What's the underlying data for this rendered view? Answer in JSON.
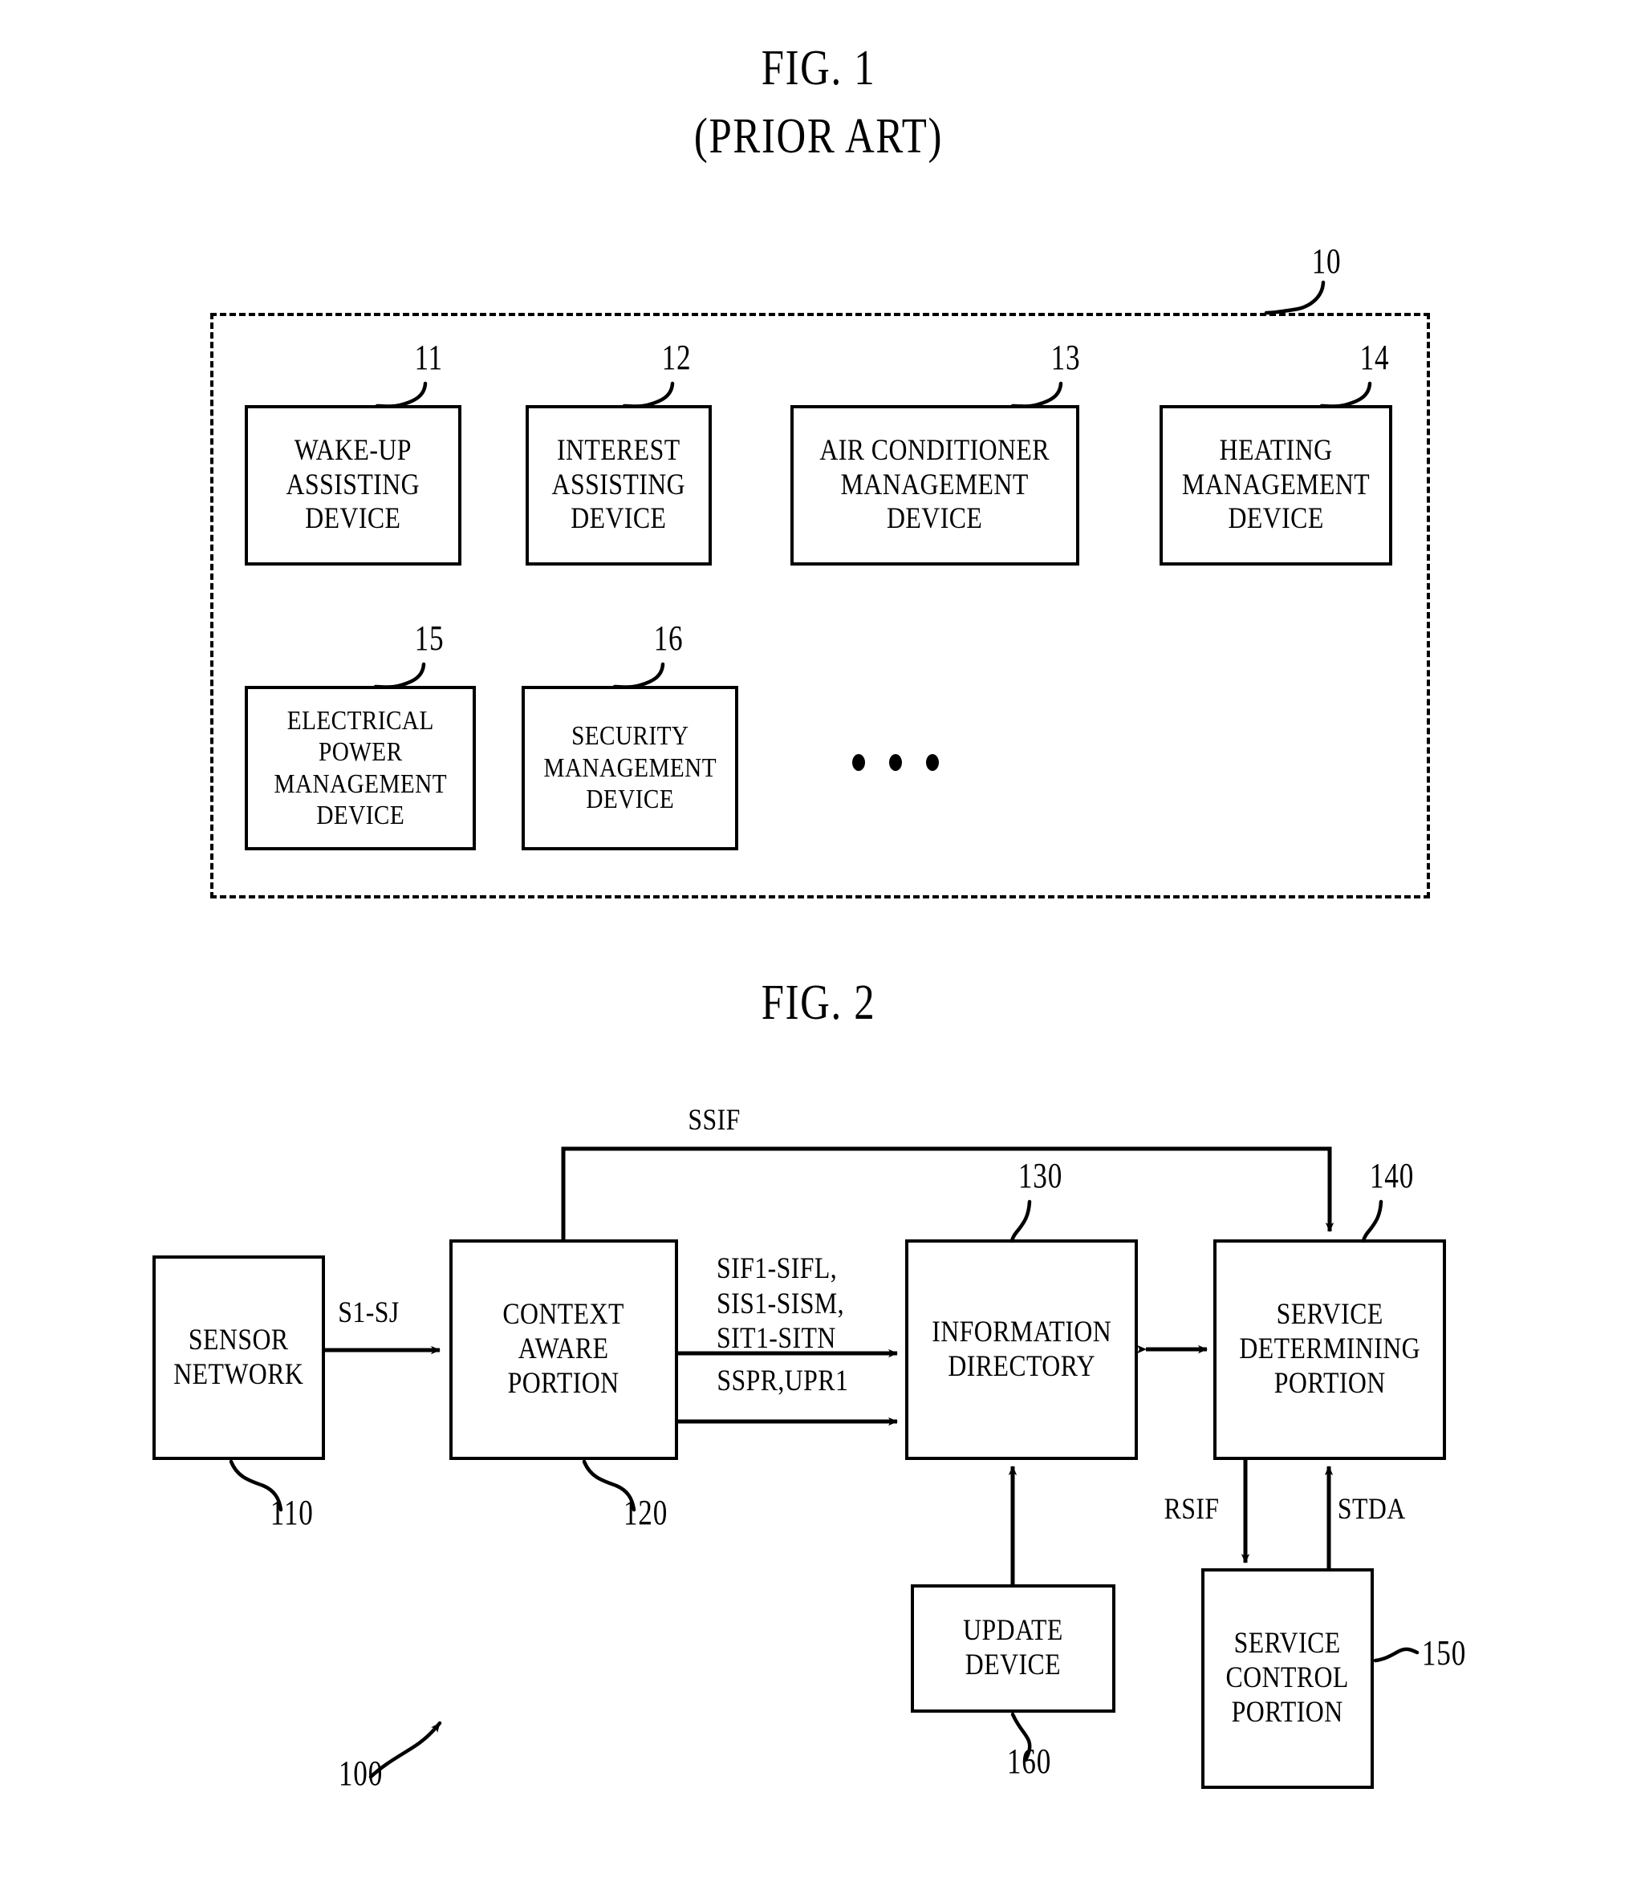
{
  "figures": [
    {
      "id": "fig1",
      "title_line1": "FIG. 1",
      "title_line2": "(PRIOR ART)",
      "container_ref": "10",
      "boxes": [
        {
          "ref": "11",
          "label": "WAKE-UP\nASSISTING\nDEVICE"
        },
        {
          "ref": "12",
          "label": "INTEREST\nASSISTING\nDEVICE"
        },
        {
          "ref": "13",
          "label": "AIR CONDITIONER\nMANAGEMENT\nDEVICE"
        },
        {
          "ref": "14",
          "label": "HEATING\nMANAGEMENT\nDEVICE"
        },
        {
          "ref": "15",
          "label": "ELECTRICAL\nPOWER\nMANAGEMENT\nDEVICE"
        },
        {
          "ref": "16",
          "label": "SECURITY\nMANAGEMENT\nDEVICE"
        }
      ],
      "ellipsis": "• • •"
    },
    {
      "id": "fig2",
      "title_line1": "FIG. 2",
      "system_ref": "100",
      "boxes": [
        {
          "ref": "110",
          "label": "SENSOR\nNETWORK"
        },
        {
          "ref": "120",
          "label": "CONTEXT\nAWARE\nPORTION"
        },
        {
          "ref": "130",
          "label": "INFORMATION\nDIRECTORY"
        },
        {
          "ref": "140",
          "label": "SERVICE\nDETERMINING\nPORTION"
        },
        {
          "ref": "150",
          "label": "SERVICE\nCONTROL\nPORTION"
        },
        {
          "ref": "160",
          "label": "UPDATE\nDEVICE"
        }
      ],
      "signals": [
        {
          "name": "sensor-to-context",
          "text": "S1-SJ"
        },
        {
          "name": "context-to-directory-upper",
          "text": "SIF1-SIFL,\nSIS1-SISM,\nSIT1-SITN"
        },
        {
          "name": "context-to-directory-lower",
          "text": "SSPR,UPR1"
        },
        {
          "name": "context-to-service-determining",
          "text": "SSIF"
        },
        {
          "name": "service-determining-to-control",
          "text": "RSIF"
        },
        {
          "name": "control-to-service-determining",
          "text": "STDA"
        }
      ]
    }
  ],
  "colors": {
    "ink": "#000000",
    "paper": "#ffffff"
  }
}
